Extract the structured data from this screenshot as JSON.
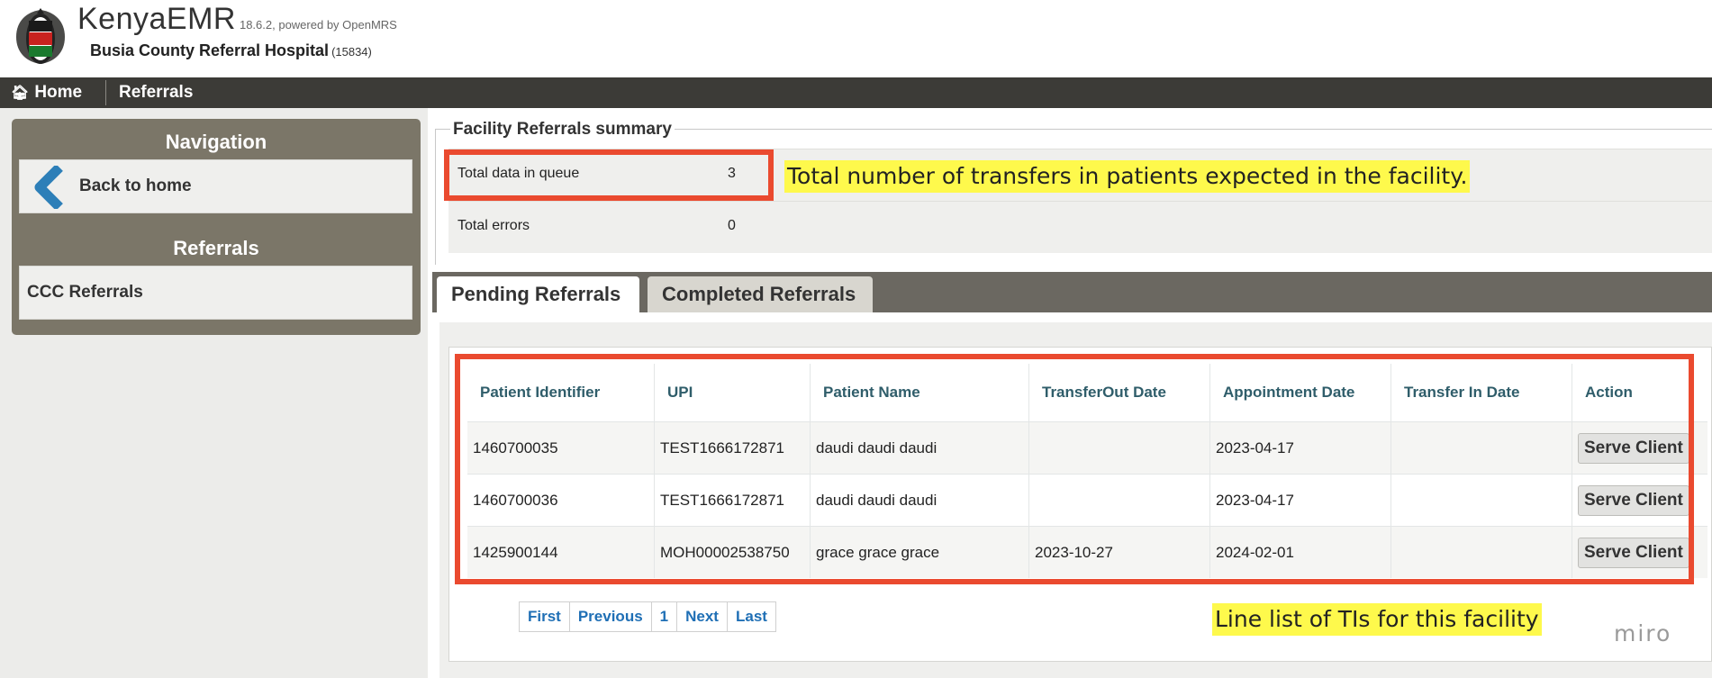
{
  "header": {
    "app_name": "KenyaEMR",
    "version": "18.6.2, powered by OpenMRS",
    "hospital_name": "Busia County Referral Hospital",
    "hospital_code": "(15834)"
  },
  "topbar": {
    "home_label": "Home",
    "current_label": "Referrals"
  },
  "sidebar": {
    "navigation_heading": "Navigation",
    "back_label": "Back to home",
    "referrals_heading": "Referrals",
    "ccc_label": "CCC Referrals"
  },
  "summary": {
    "legend": "Facility Referrals summary",
    "rows": [
      {
        "label": "Total data in queue",
        "value": "3"
      },
      {
        "label": "Total errors",
        "value": "0"
      }
    ]
  },
  "tabs": [
    {
      "label": "Pending Referrals",
      "active": true
    },
    {
      "label": "Completed Referrals",
      "active": false
    }
  ],
  "table": {
    "headers": [
      "Patient Identifier",
      "UPI",
      "Patient Name",
      "TransferOut Date",
      "Appointment Date",
      "Transfer In Date",
      "Action"
    ],
    "rows": [
      {
        "id": "1460700035",
        "upi": "TEST1666172871",
        "name": "daudi daudi daudi",
        "transfer_out": "",
        "appointment": "2023-04-17",
        "transfer_in": "",
        "action": "Serve Client"
      },
      {
        "id": "1460700036",
        "upi": "TEST1666172871",
        "name": "daudi daudi daudi",
        "transfer_out": "",
        "appointment": "2023-04-17",
        "transfer_in": "",
        "action": "Serve Client"
      },
      {
        "id": "1425900144",
        "upi": "MOH00002538750",
        "name": "grace grace grace",
        "transfer_out": "2023-10-27",
        "appointment": "2024-02-01",
        "transfer_in": "",
        "action": "Serve Client"
      }
    ]
  },
  "pagination": [
    "First",
    "Previous",
    "1",
    "Next",
    "Last"
  ],
  "annotations": {
    "queue_note": "Total number of transfers in patients expected in the facility.",
    "table_note": "Line list of TIs for this facility",
    "watermark": "miro",
    "highlight_color": "#fef94c",
    "box_color": "#ea4a2f"
  }
}
